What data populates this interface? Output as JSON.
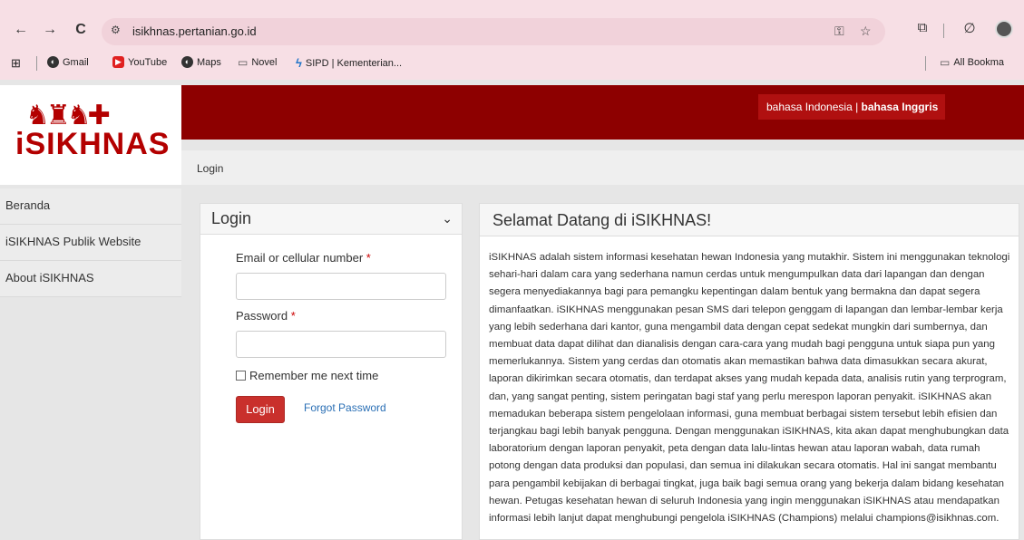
{
  "browser": {
    "url": "isikhnas.pertanian.go.id",
    "nav_icons": {
      "back": "←",
      "forward": "→",
      "reload": "C"
    },
    "bookmarks": [
      {
        "label": "Gmail",
        "icon": "globe-icon",
        "color": "#333333"
      },
      {
        "label": "YouTube",
        "icon": "youtube-icon",
        "color": "#e02020"
      },
      {
        "label": "Maps",
        "icon": "globe-icon",
        "color": "#333333"
      },
      {
        "label": "Novel",
        "icon": "folder-icon",
        "color": "#555555"
      },
      {
        "label": "SIPD | Kementerian...",
        "icon": "sipd-icon",
        "color": "#1e73c8"
      }
    ],
    "all_bookmarks": "All Bookma"
  },
  "header": {
    "logo_text": "iSIKHNAS",
    "lang_indonesia": "bahasa Indonesia",
    "lang_sep": " | ",
    "lang_english": "bahasa Inggris",
    "banner_color": "#8d0000"
  },
  "breadcrumb": "Login",
  "sidebar": {
    "items": [
      {
        "label": "Beranda"
      },
      {
        "label": "iSIKHNAS Publik Website"
      },
      {
        "label": "About iSIKHNAS"
      }
    ]
  },
  "login": {
    "title": "Login",
    "email_label": "Email or cellular number",
    "password_label": "Password",
    "required_mark": "*",
    "remember_label": "Remember me next time",
    "login_button": "Login",
    "forgot_link": "Forgot Password",
    "button_color": "#c9302c",
    "link_color": "#2a6fb5"
  },
  "welcome": {
    "title": "Selamat Datang di iSIKHNAS!",
    "body": "iSIKHNAS adalah sistem informasi kesehatan hewan Indonesia yang mutakhir. Sistem ini menggunakan teknologi sehari-hari dalam cara yang sederhana namun cerdas untuk mengumpulkan data dari lapangan dan dengan segera menyediakannya bagi para pemangku kepentingan dalam bentuk yang bermakna dan dapat segera dimanfaatkan. iSIKHNAS menggunakan pesan SMS dari telepon genggam di lapangan dan lembar-lembar kerja yang lebih sederhana dari kantor, guna mengambil data dengan cepat sedekat mungkin dari sumbernya, dan membuat data dapat dilihat dan dianalisis dengan cara-cara yang mudah bagi pengguna untuk siapa pun yang memerlukannya. Sistem yang cerdas dan otomatis akan memastikan bahwa data dimasukkan secara akurat, laporan dikirimkan secara otomatis, dan terdapat akses yang mudah kepada data, analisis rutin yang terprogram, dan, yang sangat penting, sistem peringatan bagi staf yang perlu merespon laporan penyakit. iSIKHNAS akan memadukan beberapa sistem pengelolaan informasi, guna membuat berbagai sistem tersebut lebih efisien dan terjangkau bagi lebih banyak pengguna. Dengan menggunakan iSIKHNAS, kita akan dapat menghubungkan data laboratorium dengan laporan penyakit, peta dengan data lalu-lintas hewan atau laporan wabah, data rumah potong dengan data produksi dan populasi, dan semua ini dilakukan secara otomatis. Hal ini sangat membantu para pengambil kebijakan di berbagai tingkat, juga baik bagi semua orang yang bekerja dalam bidang kesehatan hewan. Petugas kesehatan hewan di seluruh Indonesia yang ingin menggunakan iSIKHNAS atau mendapatkan informasi lebih lanjut dapat menghubungi pengelola iSIKHNAS (Champions) melalui champions@isikhnas.com."
  }
}
